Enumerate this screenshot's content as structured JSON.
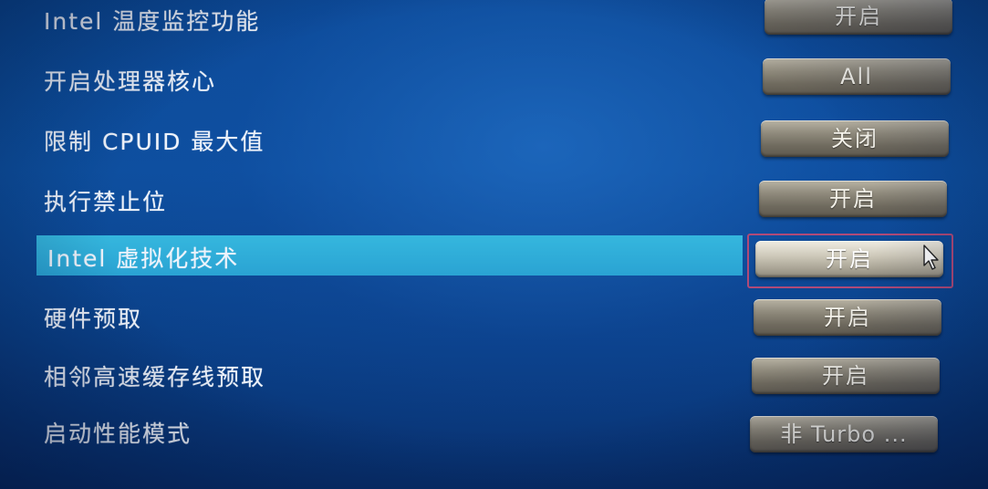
{
  "settings": {
    "items": [
      {
        "label": "Intel 温度监控功能",
        "value": "开启"
      },
      {
        "label": "开启处理器核心",
        "value": "All"
      },
      {
        "label": "限制 CPUID 最大值",
        "value": "关闭"
      },
      {
        "label": "执行禁止位",
        "value": "开启"
      },
      {
        "label": "Intel 虚拟化技术",
        "value": "开启",
        "selected": true
      },
      {
        "label": "硬件预取",
        "value": "开启"
      },
      {
        "label": "相邻高速缓存线预取",
        "value": "开启"
      },
      {
        "label": "启动性能模式",
        "value": "非 Turbo ..."
      }
    ]
  },
  "colors": {
    "background": "#0b4a96",
    "highlight": "#35b7de",
    "button": "#8f8a7c",
    "focus_border": "#b04a78"
  },
  "icons": {
    "cursor": "mouse-pointer-icon"
  }
}
